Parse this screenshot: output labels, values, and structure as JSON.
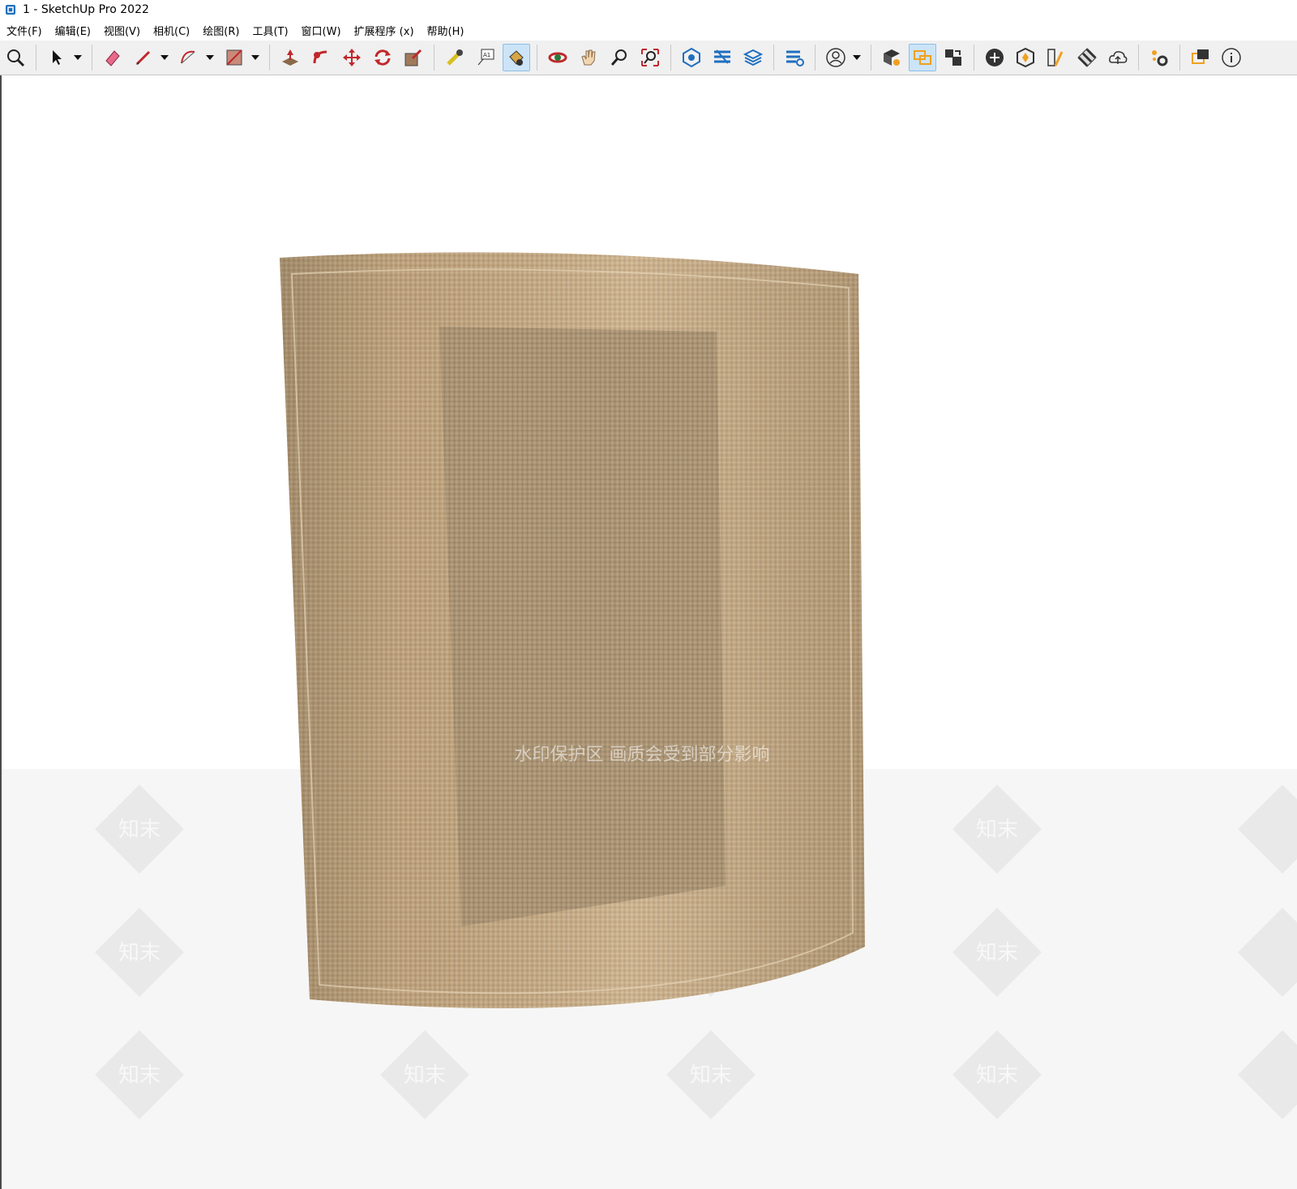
{
  "window": {
    "title": "1 - SketchUp Pro 2022"
  },
  "menu": [
    "文件(F)",
    "编辑(E)",
    "视图(V)",
    "相机(C)",
    "绘图(R)",
    "工具(T)",
    "窗口(W)",
    "扩展程序 (x)",
    "帮助(H)"
  ],
  "toolbar": {
    "buttons": [
      "zoom-extents-icon",
      "select-icon",
      "eraser-icon",
      "pencil-icon",
      "arc-icon",
      "shape-icon",
      "push-pull-icon",
      "follow-me-icon",
      "move-icon",
      "rotate-icon",
      "scale-icon",
      "tape-measure-icon",
      "text-icon",
      "paint-bucket-icon",
      "orbit-icon",
      "pan-icon",
      "zoom-icon",
      "zoom-window-icon",
      "warehouse-icon",
      "extension-icon",
      "layers-icon",
      "extension-manager-icon",
      "profile-icon",
      "solid-inspector-icon",
      "tag-transfer-icon",
      "scene-icon",
      "add-location-icon",
      "section-icon",
      "styles-icon",
      "checker-icon",
      "cloud-upload-icon",
      "settings-icon",
      "dialog-icon",
      "info-icon"
    ],
    "active": "paint-bucket-icon"
  },
  "viewport": {
    "watermark_text": "水印保护区  画质会受到部分影响",
    "tile_text": "知末",
    "material": "linen-fabric",
    "colors": {
      "fabric": "#c9ac83",
      "fabric_dark": "#a89273",
      "panel": "#a8957a",
      "ground": "#f6f6f6"
    }
  }
}
